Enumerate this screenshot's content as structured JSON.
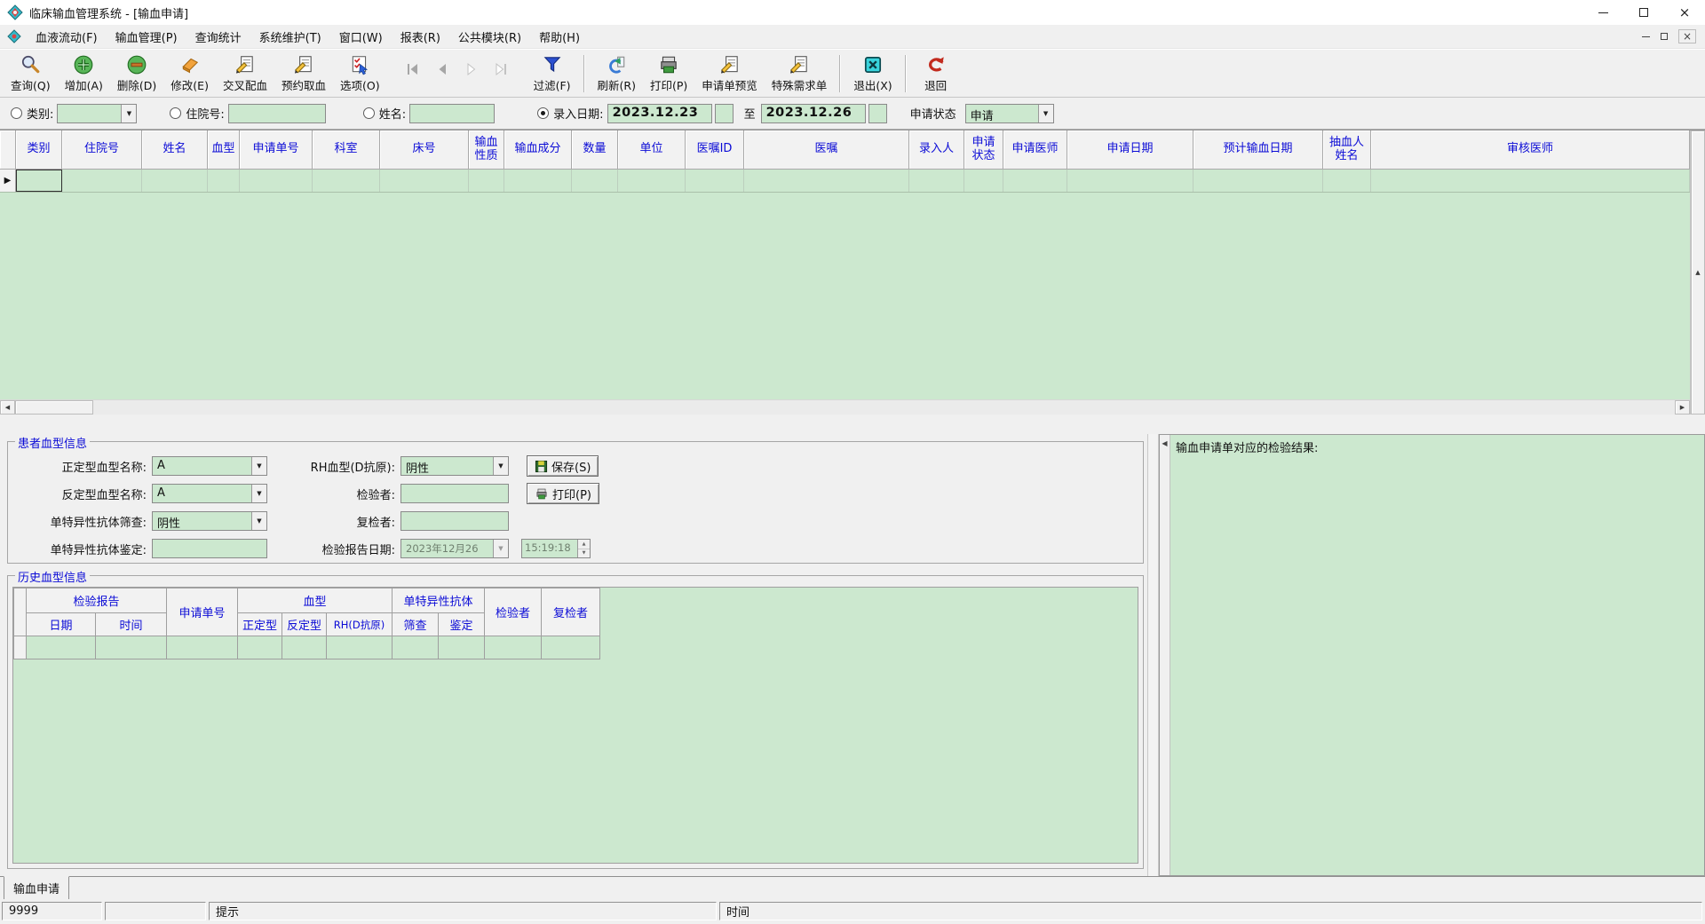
{
  "window": {
    "title": "临床输血管理系统 - [输血申请]"
  },
  "menu": {
    "items": [
      "血液流动(F)",
      "输血管理(P)",
      "查询统计",
      "系统维护(T)",
      "窗口(W)",
      "报表(R)",
      "公共模块(R)",
      "帮助(H)"
    ]
  },
  "toolbar": {
    "buttons": [
      {
        "name": "query",
        "label": "查询(Q)",
        "icon": "search-icon"
      },
      {
        "name": "add",
        "label": "增加(A)",
        "icon": "add-icon"
      },
      {
        "name": "delete",
        "label": "删除(D)",
        "icon": "delete-icon"
      },
      {
        "name": "modify",
        "label": "修改(E)",
        "icon": "edit-icon"
      },
      {
        "name": "crossmatch",
        "label": "交叉配血",
        "icon": "crossmatch-icon"
      },
      {
        "name": "reserve-blood",
        "label": "预约取血",
        "icon": "reserve-icon"
      },
      {
        "name": "options",
        "label": "选项(O)",
        "icon": "options-icon"
      },
      {
        "name": "filter",
        "label": "过滤(F)",
        "icon": "filter-icon"
      },
      {
        "name": "refresh",
        "label": "刷新(R)",
        "icon": "refresh-icon"
      },
      {
        "name": "print",
        "label": "打印(P)",
        "icon": "print-icon"
      },
      {
        "name": "request-preview",
        "label": "申请单预览",
        "icon": "preview-icon"
      },
      {
        "name": "special-request",
        "label": "特殊需求单",
        "icon": "special-request-icon"
      },
      {
        "name": "exit",
        "label": "退出(X)",
        "icon": "exit-icon"
      },
      {
        "name": "return",
        "label": "退回",
        "icon": "return-icon"
      }
    ]
  },
  "filter": {
    "category_label": "类别:",
    "category_value": "",
    "inpatient_label": "住院号:",
    "inpatient_value": "",
    "name_label": "姓名:",
    "name_value": "",
    "entry_date_label": "录入日期:",
    "date_from": "2023.12.23",
    "to_label": "至",
    "date_to": "2023.12.26",
    "status_label": "申请状态",
    "status_value": "申请"
  },
  "grid": {
    "columns": [
      "类别",
      "住院号",
      "姓名",
      "血型",
      "申请单号",
      "科室",
      "床号",
      "输血\n性质",
      "输血成分",
      "数量",
      "单位",
      "医嘱ID",
      "医嘱",
      "录入人",
      "申请\n状态",
      "申请医师",
      "申请日期",
      "预计输血日期",
      "抽血人\n姓名",
      "审核医师"
    ]
  },
  "patient_info": {
    "group_title": "患者血型信息",
    "forward_type_label": "正定型血型名称:",
    "forward_type_value": "A",
    "rh_label": "RH血型(D抗原):",
    "rh_value": "阴性",
    "reverse_type_label": "反定型血型名称:",
    "reverse_type_value": "A",
    "examiner_label": "检验者:",
    "examiner_value": "",
    "antibody_screen_label": "单特异性抗体筛查:",
    "antibody_screen_value": "阴性",
    "reviewer_label": "复检者:",
    "reviewer_value": "",
    "antibody_identify_label": "单特异性抗体鉴定:",
    "antibody_identify_value": "",
    "report_date_label": "检验报告日期:",
    "report_date_value": "2023年12月26日",
    "report_time_value": "15:19:18",
    "save_label": "保存(S)",
    "print_label": "打印(P)"
  },
  "history": {
    "group_title": "历史血型信息",
    "headers": {
      "report_group": "检验报告",
      "date": "日期",
      "time": "时间",
      "request_no": "申请单号",
      "blood_type_group": "血型",
      "forward": "正定型",
      "reverse": "反定型",
      "rh": "RH(D抗原)",
      "antibody_group": "单特异性抗体",
      "screen": "筛查",
      "identify": "鉴定",
      "examiner": "检验者",
      "reviewer": "复检者"
    }
  },
  "right_panel": {
    "title": "输血申请单对应的检验结果:"
  },
  "tabbar": {
    "active_tab": "输血申请"
  },
  "statusbar": {
    "user": "9999",
    "hint": "提示",
    "time_label": "时间"
  },
  "colors": {
    "grid_green": "#cce8cf",
    "header_blue": "#0b0bd6"
  }
}
